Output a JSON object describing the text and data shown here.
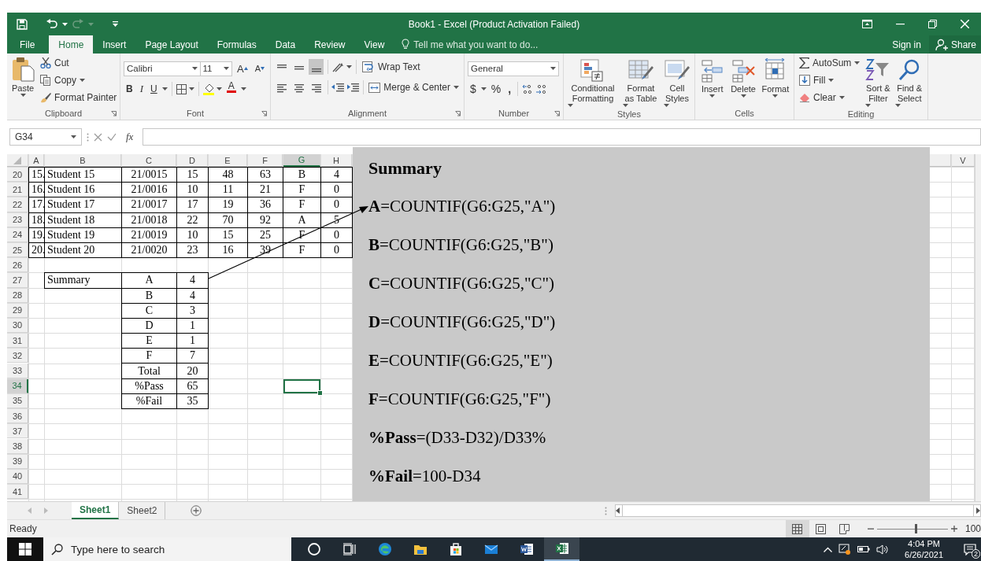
{
  "window": {
    "title": "Book1 - Excel (Product Activation Failed)"
  },
  "menu": {
    "tabs": [
      {
        "label": "File",
        "selected": false
      },
      {
        "label": "Home",
        "selected": true
      },
      {
        "label": "Insert",
        "selected": false
      },
      {
        "label": "Page Layout",
        "selected": false
      },
      {
        "label": "Formulas",
        "selected": false
      },
      {
        "label": "Data",
        "selected": false
      },
      {
        "label": "Review",
        "selected": false
      },
      {
        "label": "View",
        "selected": false
      }
    ],
    "tell_me": {
      "placeholder": "Tell me what you want to do..."
    },
    "sign_in": "Sign in",
    "share": "Share"
  },
  "ribbon": {
    "clipboard": {
      "label": "Clipboard",
      "paste": "Paste",
      "cut": "Cut",
      "copy": "Copy",
      "format_painter": "Format Painter"
    },
    "font": {
      "label": "Font",
      "font_name": "Calibri",
      "font_size": "11",
      "grow_font": "A",
      "shrink_font": "A",
      "bold": "B",
      "italic": "I",
      "underline": "U",
      "font_color": "A"
    },
    "alignment": {
      "label": "Alignment",
      "wrap_text": "Wrap Text",
      "merge_center": "Merge & Center"
    },
    "number": {
      "label": "Number",
      "format": "General",
      "currency": "$",
      "percent": "%",
      "comma": ","
    },
    "styles": {
      "label": "Styles",
      "buttons": [
        "Conditional Formatting",
        "Format as Table",
        "Cell Styles"
      ]
    },
    "cells": {
      "label": "Cells",
      "buttons": [
        "Insert",
        "Delete",
        "Format"
      ]
    },
    "editing": {
      "label": "Editing",
      "autosum": "AutoSum",
      "fill": "Fill",
      "clear": "Clear",
      "sort_filter": "Sort & Filter",
      "find_select": "Find & Select"
    }
  },
  "formula_bar": {
    "name_box": "G34",
    "function_label": "fx"
  },
  "sheet": {
    "columns": [
      {
        "label": "A",
        "selected": false
      },
      {
        "label": "B",
        "selected": false
      },
      {
        "label": "C",
        "selected": false
      },
      {
        "label": "D",
        "selected": false
      },
      {
        "label": "E",
        "selected": false
      },
      {
        "label": "F",
        "selected": false
      },
      {
        "label": "G",
        "selected": true
      },
      {
        "label": "H",
        "selected": false
      },
      {
        "label": "V",
        "selected": false
      }
    ],
    "rows": [
      {
        "number": "20",
        "selected": false,
        "a": "15.",
        "b": "Student 15",
        "c": "21/0015",
        "d": "15",
        "e": "48",
        "f": "63",
        "g": "B",
        "h": "4"
      },
      {
        "number": "21",
        "selected": false,
        "a": "16.",
        "b": "Student 16",
        "c": "21/0016",
        "d": "10",
        "e": "11",
        "f": "21",
        "g": "F",
        "h": "0"
      },
      {
        "number": "22",
        "selected": false,
        "a": "17.",
        "b": "Student 17",
        "c": "21/0017",
        "d": "17",
        "e": "19",
        "f": "36",
        "g": "F",
        "h": "0"
      },
      {
        "number": "23",
        "selected": false,
        "a": "18.",
        "b": "Student 18",
        "c": "21/0018",
        "d": "22",
        "e": "70",
        "f": "92",
        "g": "A",
        "h": "5"
      },
      {
        "number": "24",
        "selected": false,
        "a": "19.",
        "b": "Student 19",
        "c": "21/0019",
        "d": "10",
        "e": "15",
        "f": "25",
        "g": "F",
        "h": "0"
      },
      {
        "number": "25",
        "selected": false,
        "a": "20.",
        "b": "Student 20",
        "c": "21/0020",
        "d": "23",
        "e": "16",
        "f": "39",
        "g": "F",
        "h": "0"
      },
      {
        "number": "26",
        "selected": false
      },
      {
        "number": "27",
        "selected": false,
        "b": "Summary",
        "c": "A",
        "d": "4"
      },
      {
        "number": "28",
        "selected": false,
        "c": "B",
        "d": "4"
      },
      {
        "number": "29",
        "selected": false,
        "c": "C",
        "d": "3"
      },
      {
        "number": "30",
        "selected": false,
        "c": "D",
        "d": "1"
      },
      {
        "number": "31",
        "selected": false,
        "c": "E",
        "d": "1"
      },
      {
        "number": "32",
        "selected": false,
        "c": "F",
        "d": "7"
      },
      {
        "number": "33",
        "selected": false,
        "c": "Total",
        "d": "20"
      },
      {
        "number": "34",
        "selected": true,
        "c": "%Pass",
        "d": "65"
      },
      {
        "number": "35",
        "selected": false,
        "c": "%Fail",
        "d": "35"
      },
      {
        "number": "36",
        "selected": false
      },
      {
        "number": "37",
        "selected": false
      },
      {
        "number": "38",
        "selected": false
      },
      {
        "number": "39",
        "selected": false
      },
      {
        "number": "40",
        "selected": false
      },
      {
        "number": "41",
        "selected": false
      }
    ]
  },
  "panel": {
    "title": "Summary",
    "lines": [
      "**A**=COUNTIF(G6:G25,\"A\")",
      "**B**=COUNTIF(G6:G25,\"B\")",
      "**C**=COUNTIF(G6:G25,\"C\")",
      "**D**=COUNTIF(G6:G25,\"D\")",
      "**E**=COUNTIF(G6:G25,\"E\")",
      "**F**=COUNTIF(G6:G25,\"F\")",
      "**%Pass**=(D33-D32)/D33%",
      "**%Fail**=100-D34"
    ]
  },
  "sheet_tabs": [
    {
      "label": "Sheet1",
      "selected": true
    },
    {
      "label": "Sheet2",
      "selected": false
    }
  ],
  "status_bar": {
    "status": "Ready",
    "views": [
      {
        "selected": true
      },
      {
        "selected": false
      },
      {
        "selected": false
      }
    ],
    "zoom": {
      "level": 0.55
    },
    "zoom_label": "100"
  },
  "taskbar": {
    "search": {
      "placeholder": "Type here to search"
    },
    "apps": [
      {
        "selected": false
      },
      {
        "selected": false
      },
      {
        "selected": false
      },
      {
        "selected": false
      },
      {
        "selected": false
      },
      {
        "selected": false
      },
      {
        "selected": false
      },
      {
        "selected": true
      }
    ],
    "time": "4:04 PM",
    "date": "6/26/2021",
    "notifications": "2"
  }
}
